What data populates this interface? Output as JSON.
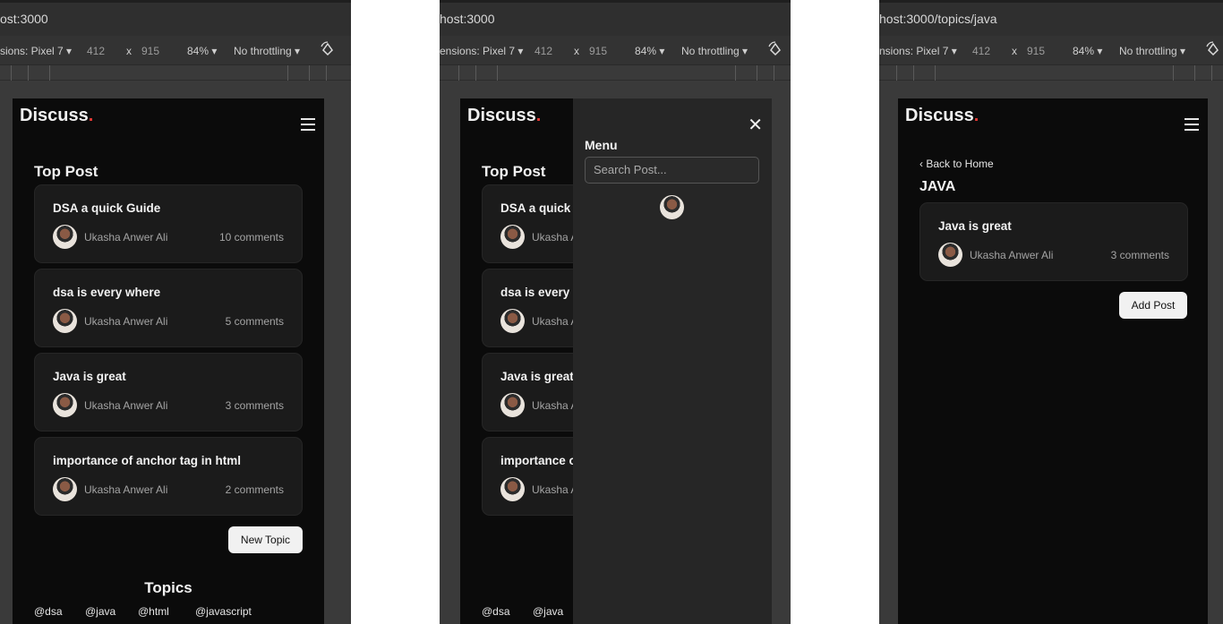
{
  "panels": [
    {
      "url": "ost:3000",
      "devtools": {
        "dimensions": "sions: Pixel 7 ▾",
        "width": "412",
        "x": "x",
        "height": "915",
        "zoom": "84% ▾",
        "throttle": "No throttling ▾"
      },
      "page": {
        "logo": "Discuss",
        "logo_dot": ".",
        "section_title": "Top Post",
        "posts": [
          {
            "title": "DSA a quick Guide",
            "author": "Ukasha Anwer Ali",
            "comments": "10 comments"
          },
          {
            "title": "dsa is every where",
            "author": "Ukasha Anwer Ali",
            "comments": "5 comments"
          },
          {
            "title": "Java is great",
            "author": "Ukasha Anwer Ali",
            "comments": "3 comments"
          },
          {
            "title": "importance of anchor tag in html",
            "author": "Ukasha Anwer Ali",
            "comments": "2 comments"
          }
        ],
        "new_topic": "New Topic",
        "topics_title": "Topics",
        "topics": [
          "@dsa",
          "@java",
          "@html",
          "@javascript"
        ]
      }
    },
    {
      "url": "host:3000",
      "devtools": {
        "dimensions": "ensions: Pixel 7 ▾",
        "width": "412",
        "x": "x",
        "height": "915",
        "zoom": "84% ▾",
        "throttle": "No throttling ▾"
      },
      "page": {
        "logo": "Discuss",
        "logo_dot": ".",
        "section_title": "Top Post",
        "posts": [
          {
            "title": "DSA a quick (",
            "author": "Ukasha A"
          },
          {
            "title": "dsa is every v",
            "author": "Ukasha A"
          },
          {
            "title": "Java is great",
            "author": "Ukasha A"
          },
          {
            "title": "importance o",
            "author": "Ukasha A"
          }
        ],
        "topics": [
          "@dsa",
          "@java"
        ],
        "drawer": {
          "close": "✕",
          "title": "Menu",
          "search_placeholder": "Search Post..."
        }
      }
    },
    {
      "url": "host:3000/topics/java",
      "devtools": {
        "dimensions": "nsions: Pixel 7 ▾",
        "width": "412",
        "x": "x",
        "height": "915",
        "zoom": "84% ▾",
        "throttle": "No throttling ▾"
      },
      "page": {
        "logo": "Discuss",
        "logo_dot": ".",
        "back": "‹  Back to Home",
        "topic_heading": "JAVA",
        "posts": [
          {
            "title": "Java is great",
            "author": "Ukasha Anwer Ali",
            "comments": "3 comments"
          }
        ],
        "add_post": "Add Post"
      }
    }
  ],
  "colors": {
    "page_bg": "#0b0b0b",
    "card_bg": "#1b1b1b",
    "drawer_bg": "#262626",
    "accent_dot": "#e53935",
    "button_bg": "#f1f1f1"
  }
}
